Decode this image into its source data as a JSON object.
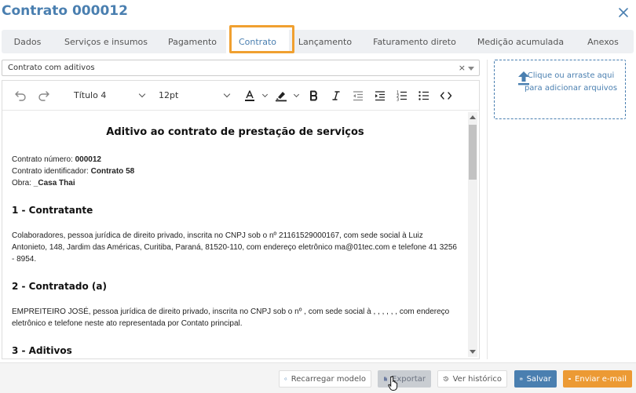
{
  "header": {
    "title": "Contrato 000012"
  },
  "tabs": [
    {
      "label": "Dados"
    },
    {
      "label": "Serviços e insumos"
    },
    {
      "label": "Pagamento"
    },
    {
      "label": "Contrato"
    },
    {
      "label": "Lançamento"
    },
    {
      "label": "Faturamento direto"
    },
    {
      "label": "Medição acumulada"
    },
    {
      "label": "Anexos"
    }
  ],
  "active_tab": "Contrato",
  "template_select": {
    "value": "Contrato com aditivos",
    "clear": "×"
  },
  "upload": {
    "text": "Clique ou arraste aqui para adicionar arquivos"
  },
  "toolbar": {
    "heading": "Título 4",
    "font_size": "12pt"
  },
  "document": {
    "title": "Aditivo ao contrato de prestação de serviços",
    "contract_number_label": "Contrato número: ",
    "contract_number": "000012",
    "contract_id_label": "Contrato identificador: ",
    "contract_id": "Contrato 58",
    "work_label": "Obra: ",
    "work": "_Casa Thai",
    "section1_title": "1 - Contratante",
    "section1_text": "Colaboradores, pessoa jurídica de direito privado, inscrita no CNPJ sob o nº 21161529000167, com sede social à Luiz Antonieto, 148, Jardim das Américas, Curitiba, Paraná, 81520-110, com endereço eletrônico ma@01tec.com e telefone 41 3256 - 8954.",
    "section2_title": "2 - Contratado (a)",
    "section2_text": "EMPREITEIRO JOSÉ, pessoa jurídica de direito privado, inscrita no CNPJ sob o nº , com sede social à , , , , , , com endereço eletrônico e telefone neste ato representada por Contato principal.",
    "section3_title": "3 - Aditivos"
  },
  "footer": {
    "reload": "Recarregar modelo",
    "export": "Exportar",
    "history": "Ver histórico",
    "save": "Salvar",
    "email": "Enviar e-mail"
  },
  "colors": {
    "accent": "#4a7fb0",
    "highlight": "#f0a030",
    "email_button": "#ec9a34"
  }
}
